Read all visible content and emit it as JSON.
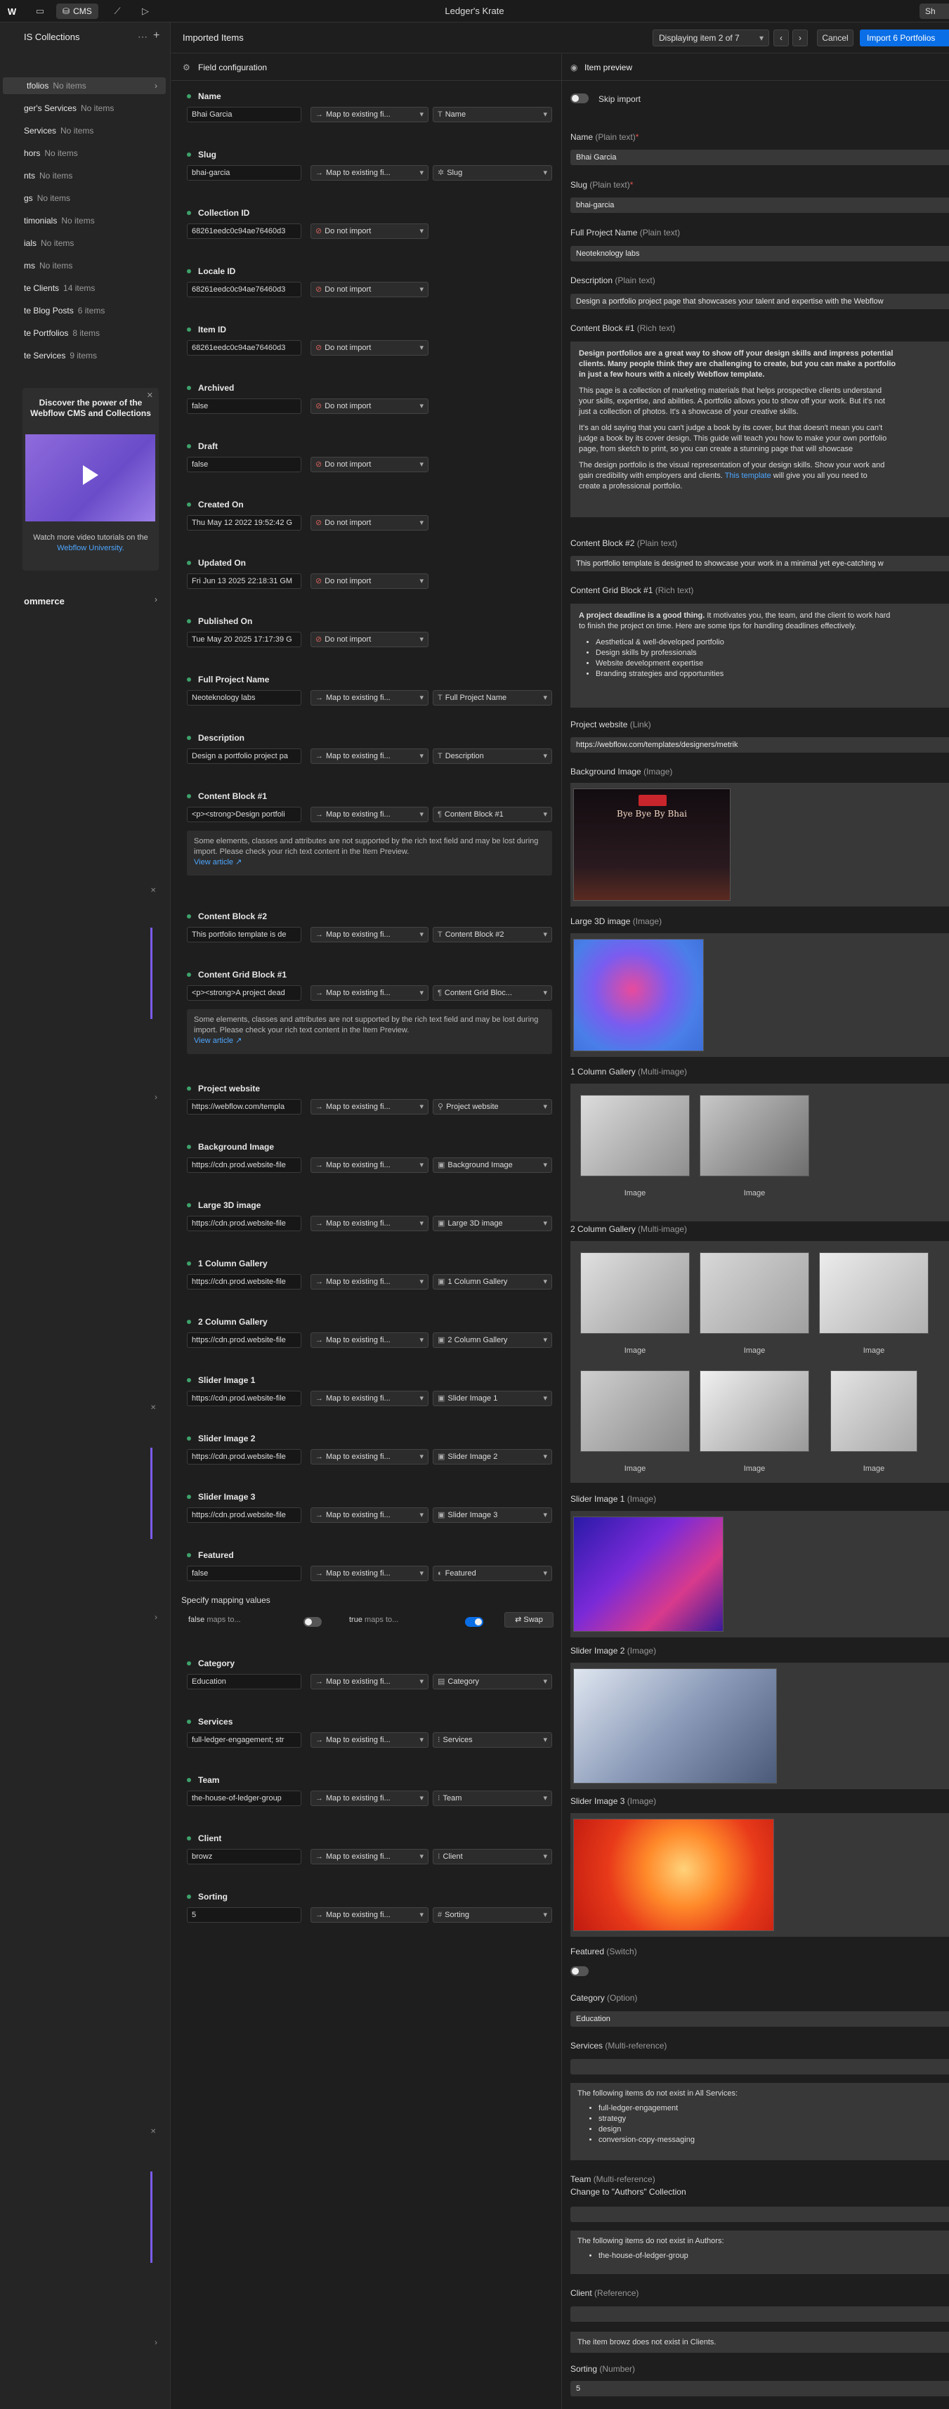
{
  "topbar": {
    "title": "Ledger's Krate",
    "tab_label": "CMS",
    "share_label": "Sh"
  },
  "sidebar": {
    "title": "IS Collections",
    "items": [
      {
        "name": "tfolios",
        "count": "No items"
      },
      {
        "name": "ger's Services",
        "count": "No items"
      },
      {
        "name": "Services",
        "count": "No items"
      },
      {
        "name": "hors",
        "count": "No items"
      },
      {
        "name": "nts",
        "count": "No items"
      },
      {
        "name": "gs",
        "count": "No items"
      },
      {
        "name": "timonials",
        "count": "No items"
      },
      {
        "name": "ials",
        "count": "No items"
      },
      {
        "name": "ms",
        "count": "No items"
      },
      {
        "name": "te Clients",
        "count": "14 items"
      },
      {
        "name": "te Blog Posts",
        "count": "6 items"
      },
      {
        "name": "te Portfolios",
        "count": "8 items"
      },
      {
        "name": "te Services",
        "count": "9 items"
      }
    ],
    "promo": {
      "title": "Discover the power of the Webflow CMS and Collections",
      "text": "Watch more video tutorials on the",
      "link": "Webflow University."
    },
    "commerce": "ommerce"
  },
  "header": {
    "title": "Imported Items",
    "display": "Displaying item 2 of 7",
    "prev": "‹",
    "next": "›",
    "cancel": "Cancel",
    "import": "Import 6 Portfolios"
  },
  "field_config": {
    "title": "Field configuration"
  },
  "fields": [
    {
      "name": "Name",
      "value": "Bhai Garcia",
      "map": "Map to existing fi...",
      "target": "Name",
      "icon": "T"
    },
    {
      "name": "Slug",
      "value": "bhai-garcia",
      "map": "Map to existing fi...",
      "target": "Slug",
      "icon": "✲"
    },
    {
      "name": "Collection ID",
      "value": "68261eedc0c94ae76460d3",
      "map": "Do not import",
      "target": "",
      "icon": ""
    },
    {
      "name": "Locale ID",
      "value": "68261eedc0c94ae76460d3",
      "map": "Do not import",
      "target": "",
      "icon": ""
    },
    {
      "name": "Item ID",
      "value": "68261eedc0c94ae76460d3",
      "map": "Do not import",
      "target": "",
      "icon": ""
    },
    {
      "name": "Archived",
      "value": "false",
      "map": "Do not import",
      "target": "",
      "icon": ""
    },
    {
      "name": "Draft",
      "value": "false",
      "map": "Do not import",
      "target": "",
      "icon": ""
    },
    {
      "name": "Created On",
      "value": "Thu May 12 2022 19:52:42 G",
      "map": "Do not import",
      "target": "",
      "icon": ""
    },
    {
      "name": "Updated On",
      "value": "Fri Jun 13 2025 22:18:31 GM",
      "map": "Do not import",
      "target": "",
      "icon": ""
    },
    {
      "name": "Published On",
      "value": "Tue May 20 2025 17:17:39 G",
      "map": "Do not import",
      "target": "",
      "icon": ""
    },
    {
      "name": "Full Project Name",
      "value": "Neoteknology labs",
      "map": "Map to existing fi...",
      "target": "Full Project Name",
      "icon": "T"
    },
    {
      "name": "Description",
      "value": "Design a portfolio project pa",
      "map": "Map to existing fi...",
      "target": "Description",
      "icon": "T"
    },
    {
      "name": "Content Block #1",
      "value": "<p><strong>Design portfoli",
      "map": "Map to existing fi...",
      "target": "Content Block #1",
      "icon": "¶"
    },
    {
      "name": "Content Block #2",
      "value": "This portfolio template is de",
      "map": "Map to existing fi...",
      "target": "Content Block #2",
      "icon": "T"
    },
    {
      "name": "Content Grid Block #1",
      "value": "<p><strong>A project dead",
      "map": "Map to existing fi...",
      "target": "Content Grid Bloc...",
      "icon": "¶"
    },
    {
      "name": "Project website",
      "value": "https://webflow.com/templa",
      "map": "Map to existing fi...",
      "target": "Project website",
      "icon": "⚲"
    },
    {
      "name": "Background Image",
      "value": "https://cdn.prod.website-file",
      "map": "Map to existing fi...",
      "target": "Background Image",
      "icon": "▣"
    },
    {
      "name": "Large 3D image",
      "value": "https://cdn.prod.website-file",
      "map": "Map to existing fi...",
      "target": "Large 3D image",
      "icon": "▣"
    },
    {
      "name": "1 Column Gallery",
      "value": "https://cdn.prod.website-file",
      "map": "Map to existing fi...",
      "target": "1 Column Gallery",
      "icon": "▣"
    },
    {
      "name": "2 Column Gallery",
      "value": "https://cdn.prod.website-file",
      "map": "Map to existing fi...",
      "target": "2 Column Gallery",
      "icon": "▣"
    },
    {
      "name": "Slider Image 1",
      "value": "https://cdn.prod.website-file",
      "map": "Map to existing fi...",
      "target": "Slider Image 1",
      "icon": "▣"
    },
    {
      "name": "Slider Image 2",
      "value": "https://cdn.prod.website-file",
      "map": "Map to existing fi...",
      "target": "Slider Image 2",
      "icon": "▣"
    },
    {
      "name": "Slider Image 3",
      "value": "https://cdn.prod.website-file",
      "map": "Map to existing fi...",
      "target": "Slider Image 3",
      "icon": "▣"
    },
    {
      "name": "Featured",
      "value": "false",
      "map": "Map to existing fi...",
      "target": "Featured",
      "icon": "◐"
    },
    {
      "name": "Category",
      "value": "Education",
      "map": "Map to existing fi...",
      "target": "Category",
      "icon": "▤"
    },
    {
      "name": "Services",
      "value": "full-ledger-engagement; str",
      "map": "Map to existing fi...",
      "target": "Services",
      "icon": "⁝"
    },
    {
      "name": "Team",
      "value": "the-house-of-ledger-group",
      "map": "Map to existing fi...",
      "target": "Team",
      "icon": "⁝"
    },
    {
      "name": "Client",
      "value": "browz",
      "map": "Map to existing fi...",
      "target": "Client",
      "icon": "⁝"
    },
    {
      "name": "Sorting",
      "value": "5",
      "map": "Map to existing fi...",
      "target": "Sorting",
      "icon": "#"
    }
  ],
  "rich_warning": {
    "text": "Some elements, classes and attributes are not supported by the rich text field and may be lost during import. Please check your rich text content in the Item Preview.",
    "link": "View article ↗"
  },
  "mapping": {
    "title": "Specify mapping values",
    "false_label": "false",
    "true_label": "true",
    "maps_to": "maps to...",
    "swap": "Swap"
  },
  "preview": {
    "title": "Item preview",
    "skip": "Skip import",
    "name_label": "Name",
    "name_type": "(Plain text)",
    "name_value": "Bhai Garcia",
    "slug_label": "Slug",
    "slug_type": "(Plain text)",
    "slug_value": "bhai-garcia",
    "fpn_label": "Full Project Name",
    "fpn_type": "(Plain text)",
    "fpn_value": "Neoteknology labs",
    "desc_label": "Description",
    "desc_type": "(Plain text)",
    "desc_value": "Design a portfolio project page that showcases your talent and expertise with the Webflow",
    "cb1_label": "Content Block #1",
    "cb1_type": "(Rich text)",
    "cb1_p1": "Design portfolios are a great way to show off your design skills and impress potential",
    "cb1_p1b": "clients. Many people think they are challenging to create, but you can make a portfolio",
    "cb1_p1c": "in just a few hours with a nicely Webflow template.",
    "cb1_p2": "This page is a collection of marketing materials that helps prospective clients understand",
    "cb1_p2b": "your skills, expertise, and abilities. A portfolio allows you to show off your work. But it's not",
    "cb1_p2c": "just a collection of photos. It's a showcase of your creative skills.",
    "cb1_p3": "It's an old saying that you can't judge a book by its cover, but that doesn't mean you can't",
    "cb1_p3b": "judge a book by its cover design. This guide will teach you how to make your own portfolio",
    "cb1_p3c": "page, from sketch to print, so you can create a stunning page that will showcase",
    "cb1_p4": "The design portfolio is the visual representation of your design skills. Show your work and",
    "cb1_p4b": "gain credibility with employers and clients.",
    "cb1_p4_link": "This template",
    "cb1_p4c": "will give you all you need to",
    "cb1_p4d": "create a professional portfolio.",
    "cb2_label": "Content Block #2",
    "cb2_type": "(Plain text)",
    "cb2_value": "This portfolio template is designed to showcase your work in a minimal yet eye-catching w",
    "cgb_label": "Content Grid Block #1",
    "cgb_type": "(Rich text)",
    "cgb_p_strong": "A project deadline is a good thing.",
    "cgb_p": "It motivates you, the team, and the client to work hard",
    "cgb_p2": "to finish the project on time. Here are some tips for handling deadlines effectively.",
    "cgb_list": [
      "Aesthetical & well-developed portfolio",
      "Design skills by professionals",
      "Website development expertise",
      "Branding strategies and opportunities"
    ],
    "pw_label": "Project website",
    "pw_type": "(Link)",
    "pw_value": "https://webflow.com/templates/designers/metrik",
    "bg_label": "Background Image",
    "bg_type": "(Image)",
    "bg_img_title": "Bye Bye By Bhai",
    "l3d_label": "Large 3D image",
    "l3d_type": "(Image)",
    "g1_label": "1 Column Gallery",
    "g1_type": "(Multi-image)",
    "g2_label": "2 Column Gallery",
    "g2_type": "(Multi-image)",
    "image_caption": "Image",
    "s1_label": "Slider Image 1",
    "s1_type": "(Image)",
    "s2_label": "Slider Image 2",
    "s2_type": "(Image)",
    "s3_label": "Slider Image 3",
    "s3_type": "(Image)",
    "feat_label": "Featured",
    "feat_type": "(Switch)",
    "cat_label": "Category",
    "cat_type": "(Option)",
    "cat_value": "Education",
    "svc_label": "Services",
    "svc_type": "(Multi-reference)",
    "svc_note": "The following items do not exist in All Services:",
    "svc_list": [
      "full-ledger-engagement",
      "strategy",
      "design",
      "conversion-copy-messaging"
    ],
    "team_label": "Team",
    "team_type": "(Multi-reference)",
    "team_change": "Change to \"Authors\" Collection",
    "team_note": "The following items do not exist in Authors:",
    "team_list": [
      "the-house-of-ledger-group"
    ],
    "client_label": "Client",
    "client_type": "(Reference)",
    "client_note": "The item browz does not exist in Clients.",
    "sort_label": "Sorting",
    "sort_type": "(Number)",
    "sort_value": "5"
  }
}
